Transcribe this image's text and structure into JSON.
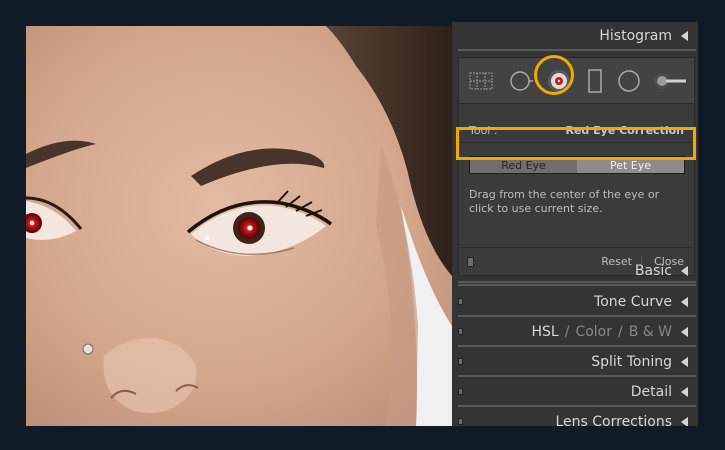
{
  "panels": {
    "histogram": "Histogram",
    "basic": "Basic",
    "tone_curve": "Tone Curve",
    "hsl": "HSL",
    "hsl_slash": "/",
    "color": "Color",
    "bw": "B & W",
    "split_toning": "Split Toning",
    "detail": "Detail",
    "lens_corrections": "Lens Corrections"
  },
  "tool": {
    "label": "Tool :",
    "name": "Red Eye Correction",
    "mode_red": "Red Eye",
    "mode_pet": "Pet Eye",
    "selected_mode": "Pet Eye",
    "hint": "Drag from the center of the eye or click to use current size.",
    "reset": "Reset",
    "close": "Close"
  },
  "colors": {
    "highlight": "#f2a800",
    "panel_bg": "#343434",
    "page_bg": "#0f1b27"
  },
  "icons": [
    "grid-overlay-icon",
    "crop-icon",
    "spot-removal-icon",
    "red-eye-icon",
    "graduated-filter-icon",
    "radial-filter-icon",
    "adjustment-brush-icon"
  ]
}
